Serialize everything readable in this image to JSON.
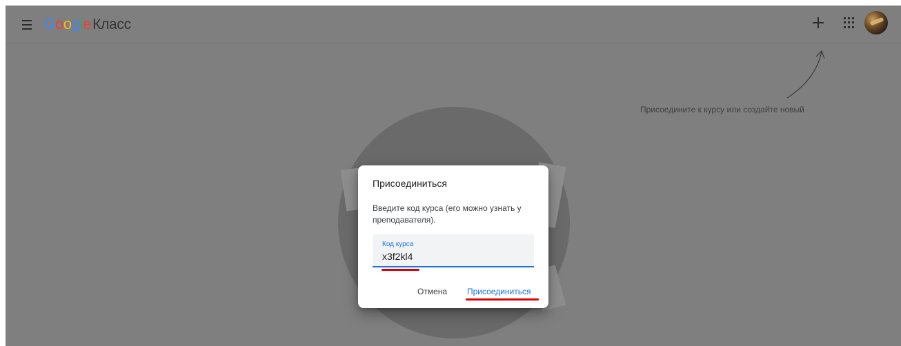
{
  "header": {
    "logo_brand_letters": [
      "G",
      "o",
      "o",
      "g",
      "l",
      "e"
    ],
    "logo_brand_colors": [
      "#4285f4",
      "#ea4335",
      "#fbbc05",
      "#4285f4",
      "#34a853",
      "#ea4335"
    ],
    "logo_product": "Класс",
    "menu_icon": "hamburger-menu-icon",
    "plus_icon": "plus-icon",
    "apps_icon": "apps-grid-icon",
    "avatar_icon": "user-avatar"
  },
  "hint": {
    "text": "Присоедините к курсу или создайте новый"
  },
  "dialog": {
    "title": "Присоединиться",
    "description": "Введите код курса (его можно узнать у преподавателя).",
    "code_label": "Код курса",
    "code_value": "x3f2kl4",
    "cancel_label": "Отмена",
    "join_label": "Присоединиться"
  },
  "colors": {
    "accent": "#1a73e8",
    "annotation_red": "#e00000",
    "overlay": "#7f7f7f"
  }
}
